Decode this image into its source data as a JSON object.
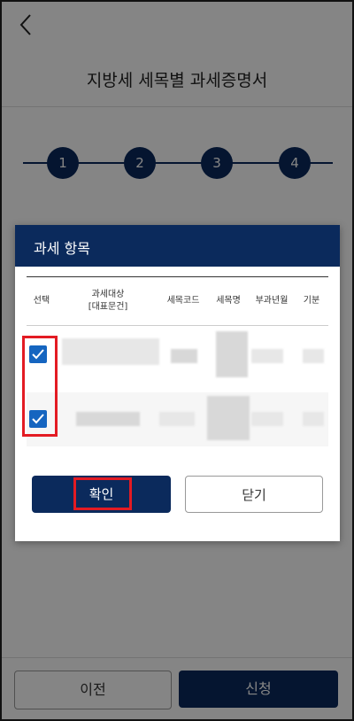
{
  "header": {
    "back_icon": "chevron-left-icon"
  },
  "page": {
    "title": "지방세 세목별 과세증명서",
    "steps": [
      "1",
      "2",
      "3",
      "4"
    ]
  },
  "footer": {
    "prev_label": "이전",
    "apply_label": "신청"
  },
  "modal": {
    "title": "과세 항목",
    "columns": [
      "선택",
      "과세대상\n[대표문건]",
      "세목코드",
      "세목명",
      "부과년월",
      "기분"
    ],
    "rows": [
      {
        "checked": true
      },
      {
        "checked": true
      }
    ],
    "confirm_label": "확인",
    "close_label": "닫기"
  },
  "colors": {
    "primary": "#0b2a5c",
    "checkbox": "#1565c0",
    "highlight": "#e31b23"
  }
}
